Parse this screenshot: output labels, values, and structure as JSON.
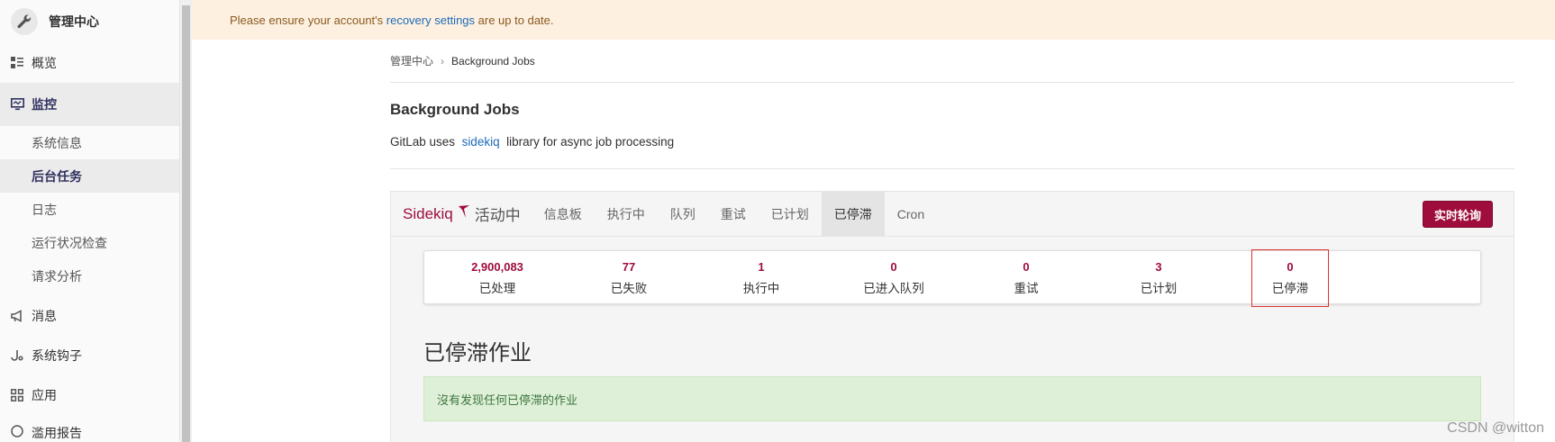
{
  "sidebar": {
    "title": "管理中心",
    "items": [
      {
        "label": "概览"
      },
      {
        "label": "监控"
      },
      {
        "label": "消息"
      },
      {
        "label": "系统钩子"
      },
      {
        "label": "应用"
      },
      {
        "label": "滥用报告"
      }
    ],
    "submenu": [
      {
        "label": "系统信息"
      },
      {
        "label": "后台任务"
      },
      {
        "label": "日志"
      },
      {
        "label": "运行状况检查"
      },
      {
        "label": "请求分析"
      }
    ]
  },
  "alert": {
    "prefix": "Please ensure your account's ",
    "link": "recovery settings",
    "suffix": " are up to date."
  },
  "breadcrumb": {
    "parent": "管理中心",
    "separator": "›",
    "current": "Background Jobs"
  },
  "page": {
    "title": "Background Jobs",
    "desc_prefix": "GitLab uses ",
    "desc_link": "sidekiq",
    "desc_suffix": " library for async job processing"
  },
  "sidekiq": {
    "brand": "Sidekiq",
    "status": "活动中",
    "tabs": [
      "信息板",
      "执行中",
      "队列",
      "重试",
      "已计划",
      "已停滞",
      "Cron"
    ],
    "live_button": "实时轮询",
    "stats": [
      {
        "num": "2,900,083",
        "label": "已处理"
      },
      {
        "num": "77",
        "label": "已失败"
      },
      {
        "num": "1",
        "label": "执行中"
      },
      {
        "num": "0",
        "label": "已进入队列"
      },
      {
        "num": "0",
        "label": "重试"
      },
      {
        "num": "3",
        "label": "已计划"
      },
      {
        "num": "0",
        "label": "已停滞"
      }
    ],
    "section_title": "已停滞作业",
    "empty_message": "沒有发现任何已停滞的作业"
  },
  "watermark": "CSDN @witton",
  "colors": {
    "accent": "#9e0d3c",
    "alert_bg": "#fdf0e0",
    "success_bg": "#dff0d8"
  }
}
